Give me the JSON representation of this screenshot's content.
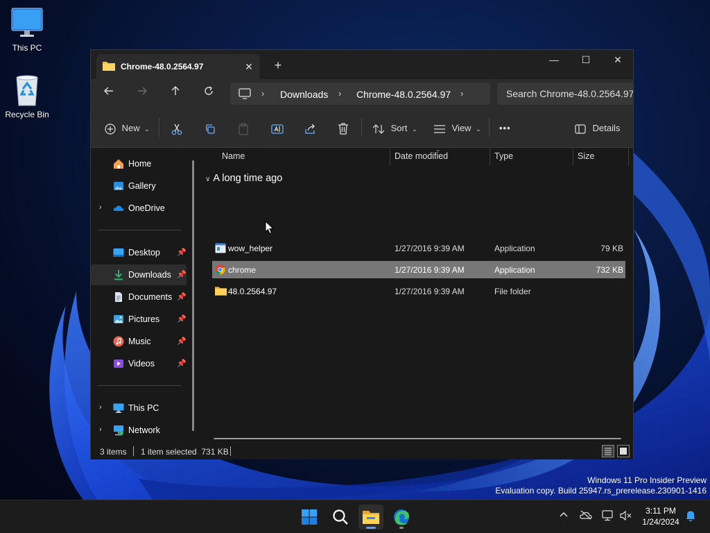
{
  "desktop": {
    "icons": [
      {
        "label": "This PC",
        "icon": "monitor-icon"
      },
      {
        "label": "Recycle Bin",
        "icon": "recycle-bin-icon"
      }
    ],
    "watermark": {
      "line1": "Windows 11 Pro Insider Preview",
      "line2": "Evaluation copy. Build 25947.rs_prerelease.230901-1416"
    }
  },
  "window": {
    "tab_title": "Chrome-48.0.2564.97",
    "controls": {
      "close_tab": "✕",
      "new_tab": "+",
      "minimize": "—",
      "maximize": "☐",
      "close": "✕"
    },
    "breadcrumb": [
      "Downloads",
      "Chrome-48.0.2564.97"
    ],
    "search_placeholder": "Search Chrome-48.0.2564.97",
    "toolbar": {
      "new_label": "New",
      "sort_label": "Sort",
      "view_label": "View",
      "more_label": "•••",
      "details_label": "Details"
    },
    "sidebar": {
      "items": [
        {
          "label": "Home",
          "icon": "home-icon",
          "chevron": false,
          "pinned": false
        },
        {
          "label": "Gallery",
          "icon": "gallery-icon",
          "chevron": false,
          "pinned": false
        },
        {
          "label": "OneDrive",
          "icon": "onedrive-icon",
          "chevron": true,
          "pinned": false
        },
        {
          "label": "Desktop",
          "icon": "desktop-icon",
          "chevron": false,
          "pinned": true
        },
        {
          "label": "Downloads",
          "icon": "download-icon",
          "chevron": false,
          "pinned": true
        },
        {
          "label": "Documents",
          "icon": "documents-icon",
          "chevron": false,
          "pinned": true
        },
        {
          "label": "Pictures",
          "icon": "pictures-icon",
          "chevron": false,
          "pinned": true
        },
        {
          "label": "Music",
          "icon": "music-icon",
          "chevron": false,
          "pinned": true
        },
        {
          "label": "Videos",
          "icon": "videos-icon",
          "chevron": false,
          "pinned": true
        },
        {
          "label": "This PC",
          "icon": "this-pc-icon",
          "chevron": true,
          "pinned": false
        },
        {
          "label": "Network",
          "icon": "network-icon",
          "chevron": true,
          "pinned": false
        }
      ],
      "selected": "Downloads"
    },
    "columns": [
      "Name",
      "Date modified",
      "Type",
      "Size"
    ],
    "group_header": "A long time ago",
    "files": [
      {
        "name": "wow_helper",
        "date": "1/27/2016 9:39 AM",
        "type": "Application",
        "size": "79 KB",
        "icon": "application-icon",
        "selected": false
      },
      {
        "name": "chrome",
        "date": "1/27/2016 9:39 AM",
        "type": "Application",
        "size": "732 KB",
        "icon": "chrome-icon",
        "selected": true
      },
      {
        "name": "48.0.2564.97",
        "date": "1/27/2016 9:39 AM",
        "type": "File folder",
        "size": "",
        "icon": "folder-icon",
        "selected": false
      }
    ],
    "status": {
      "items_count": "3 items",
      "selection": "1 item selected  731 KB"
    }
  },
  "taskbar": {
    "apps": [
      "start-icon",
      "search-icon",
      "file-explorer-icon",
      "edge-icon"
    ],
    "tray": {
      "chevron": "^"
    },
    "clock": {
      "time": "3:11 PM",
      "date": "1/24/2024"
    }
  },
  "colors": {
    "accent": "#0078d4",
    "selection": "#777777",
    "window_bg": "#191919",
    "toolbar_bg": "#2c2c2c",
    "taskbar_bg": "#1c1c1c"
  }
}
